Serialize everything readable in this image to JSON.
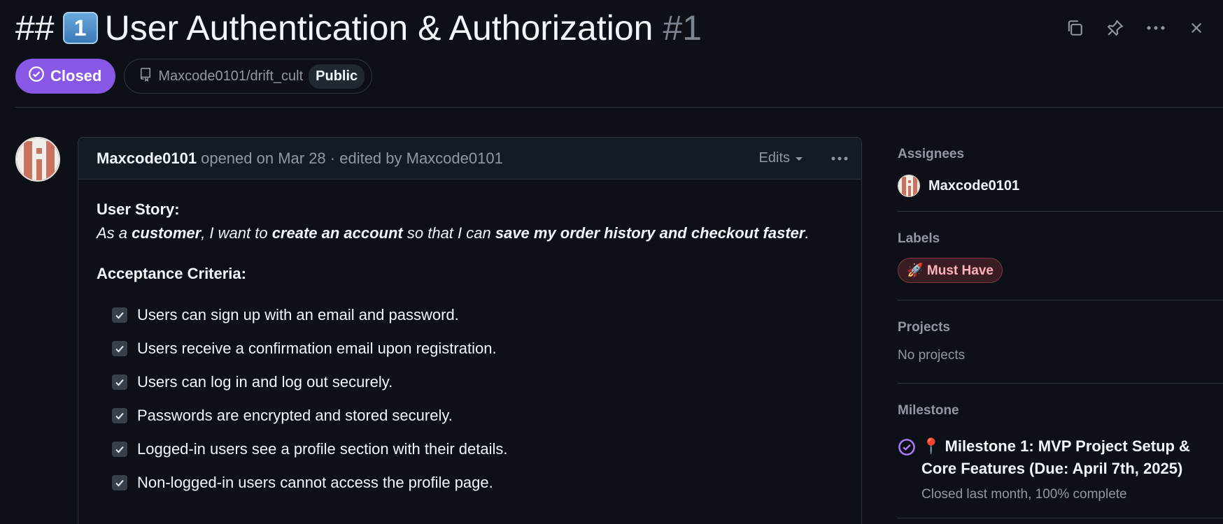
{
  "header": {
    "title_prefix": "##",
    "keycap": "1",
    "title": "User Authentication & Authorization",
    "number": "#1"
  },
  "toolbar": {
    "copy_icon": "copy-icon",
    "pin_icon": "pin-icon",
    "more_icon": "kebab-horizontal-icon",
    "close_icon": "close-icon"
  },
  "meta": {
    "state": "Closed",
    "state_color": "#8957e5",
    "repo": "Maxcode0101/drift_cult",
    "visibility": "Public"
  },
  "comment": {
    "author": "Maxcode0101",
    "meta": "opened on Mar 28 · edited by Maxcode0101",
    "edits_label": "Edits",
    "story_label": "User Story:",
    "story": {
      "p1": "As a ",
      "b1": "customer",
      "p2": ", I want to ",
      "b2": "create an account",
      "p3": " so that I can ",
      "b3": "save my order history and checkout faster",
      "p4": "."
    },
    "criteria_label": "Acceptance Criteria:",
    "criteria": [
      "Users can sign up with an email and password.",
      "Users receive a confirmation email upon registration.",
      "Users can log in and log out securely.",
      "Passwords are encrypted and stored securely.",
      "Logged-in users see a profile section with their details.",
      "Non-logged-in users cannot access the profile page."
    ]
  },
  "sidebar": {
    "assignees_heading": "Assignees",
    "assignee": "Maxcode0101",
    "labels_heading": "Labels",
    "label": "🚀 Must Have",
    "projects_heading": "Projects",
    "projects_value": "No projects",
    "milestone_heading": "Milestone",
    "milestone_title": "📍 Milestone 1: MVP Project Setup & Core Features (Due: April 7th, 2025)",
    "milestone_status": "Closed last month, 100% complete"
  }
}
